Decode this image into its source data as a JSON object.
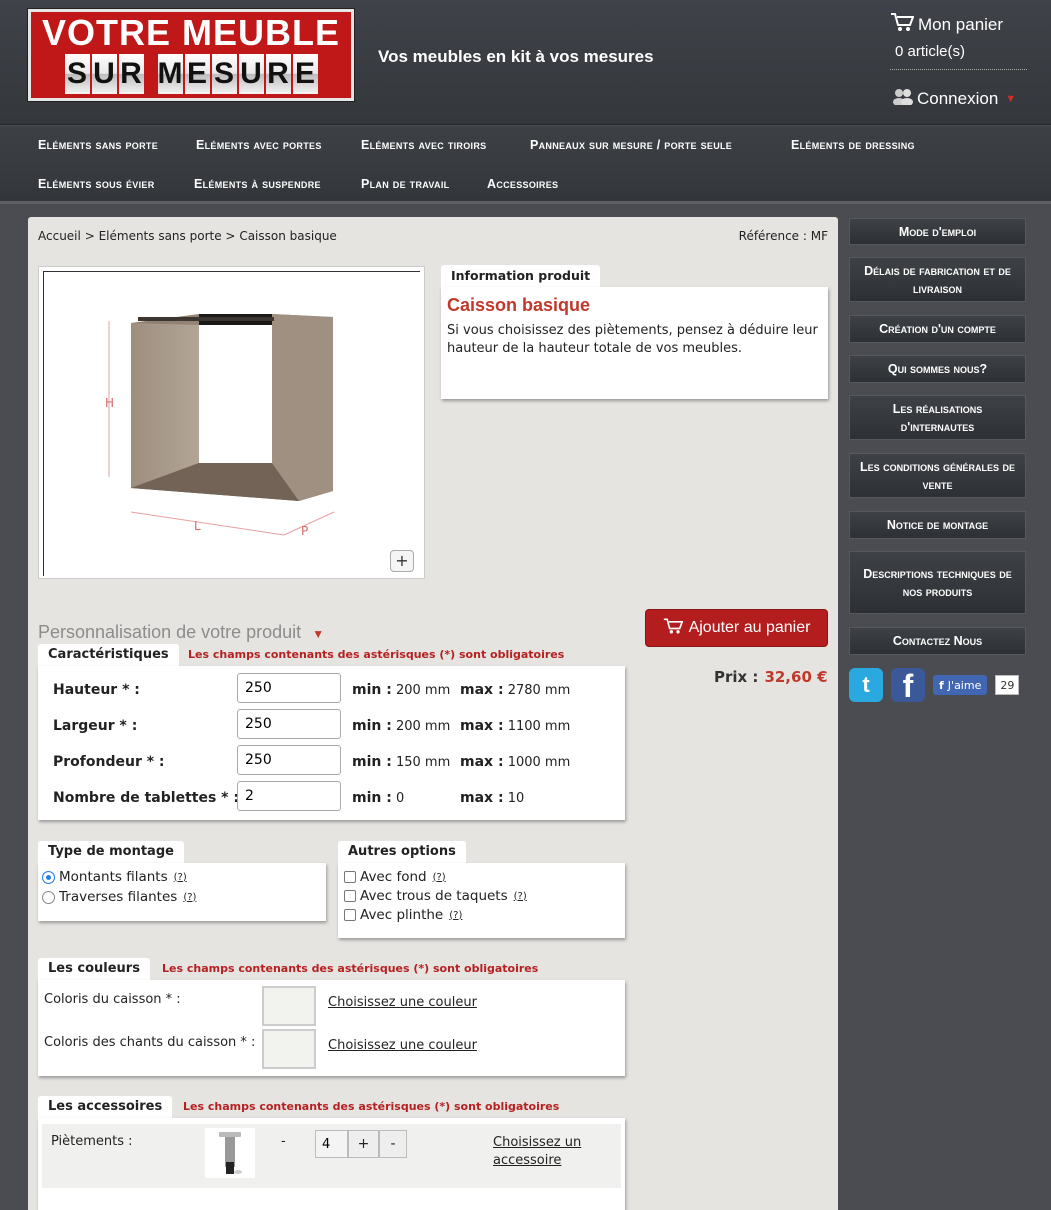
{
  "header": {
    "logo_top": "VOTRE MEUBLE",
    "logo_bottom": "SUR MESURE",
    "tagline": "Vos meubles en kit à vos mesures",
    "cart_label": "Mon panier",
    "cart_count": "0 article(s)",
    "login_label": "Connexion"
  },
  "nav": {
    "items": [
      "Eléments sans porte",
      "Eléments avec portes",
      "Eléments avec tiroirs",
      "Panneaux sur mesure / porte seule",
      "Eléments de dressing",
      "Eléments sous évier",
      "Eléments à suspendre",
      "Plan de travail",
      "Accessoires"
    ]
  },
  "breadcrumb": {
    "items": [
      "Accueil",
      "Eléments sans porte",
      "Caisson basique"
    ],
    "sep": ">"
  },
  "reference": "Référence : MF",
  "product": {
    "info_tab": "Information produit",
    "name": "Caisson basique",
    "description": "Si vous choisissez des piètements, pensez à déduire leur hauteur de la hauteur totale de vos meubles.",
    "zoom": "+",
    "dim_h": "H",
    "dim_l": "L",
    "dim_p": "P"
  },
  "personnalisation": {
    "title": "Personnalisation de votre produit",
    "add_to_cart": "Ajouter au panier",
    "price_label": "Prix :",
    "price_value": "32,60 €"
  },
  "caracteristiques": {
    "tab": "Caractéristiques",
    "required_note": "Les champs contenants des astérisques (*) sont obligatoires",
    "min_label": "min :",
    "max_label": "max :",
    "fields": [
      {
        "label": "Hauteur * :",
        "value": "250",
        "min": "200 mm",
        "max": "2780 mm"
      },
      {
        "label": "Largeur * :",
        "value": "250",
        "min": "200 mm",
        "max": "1100 mm"
      },
      {
        "label": "Profondeur * :",
        "value": "250",
        "min": "150 mm",
        "max": "1000 mm"
      },
      {
        "label": "Nombre de tablettes * :",
        "value": "2",
        "min": "0",
        "max": "10"
      }
    ]
  },
  "montage": {
    "tab": "Type de montage",
    "options": [
      "Montants filants",
      "Traverses filantes"
    ],
    "selected": "Montants filants",
    "help": "(?)"
  },
  "autres": {
    "tab": "Autres options",
    "options": [
      "Avec fond",
      "Avec trous de taquets",
      "Avec plinthe"
    ],
    "help": "(?)"
  },
  "couleurs": {
    "tab": "Les couleurs",
    "required_note": "Les champs contenants des astérisques (*) sont obligatoires",
    "rows": [
      {
        "label": "Coloris du caisson * :",
        "choose": "Choisissez une couleur"
      },
      {
        "label": "Coloris des chants du caisson * :",
        "choose": "Choisissez une couleur"
      }
    ]
  },
  "accessoires": {
    "tab": "Les accessoires",
    "required_note": "Les champs contenants des astérisques (*) sont obligatoires",
    "rows": [
      {
        "label": "Piètements :",
        "dash": "-",
        "qty": "4",
        "plus": "+",
        "minus": "-",
        "choose": "Choisissez un accessoire"
      }
    ]
  },
  "sidebar": {
    "items": [
      "Mode d'emploi",
      "Délais de fabrication et de livraison",
      "Création d'un compte",
      "Qui sommes nous?",
      "Les réalisations d'internautes",
      "Les conditions générales de vente",
      "Notice de montage",
      "Descriptions techniques de nos produits",
      "Contactez Nous"
    ]
  },
  "social": {
    "like_label": "J'aime",
    "like_count": "29",
    "twitter_icon": "twitter-icon",
    "facebook_icon": "facebook-icon"
  },
  "colors": {
    "brand_red": "#c01818",
    "accent_red": "#c0392b",
    "dark_bg": "#4a4c51",
    "panel_bg": "#e5e4e1"
  }
}
